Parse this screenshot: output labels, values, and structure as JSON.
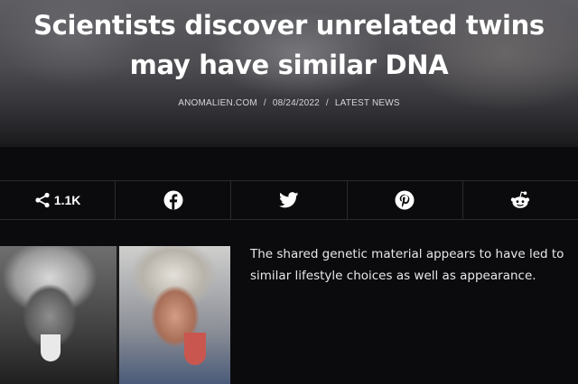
{
  "article": {
    "title": "Scientists discover unrelated twins may have similar DNA",
    "meta": {
      "source": "ANOMALIEN.COM",
      "date": "08/24/2022",
      "category": "LATEST NEWS",
      "separator": "/"
    },
    "body_text": "The shared genetic material appears to have led to similar lifestyle choices as well as appearance."
  },
  "share_bar": {
    "count": "1.1K",
    "buttons": [
      {
        "name": "share",
        "icon": "share-icon"
      },
      {
        "name": "facebook",
        "icon": "facebook-icon"
      },
      {
        "name": "twitter",
        "icon": "twitter-icon"
      },
      {
        "name": "pinterest",
        "icon": "pinterest-icon"
      },
      {
        "name": "reddit",
        "icon": "reddit-icon"
      }
    ]
  },
  "image": {
    "description_icon": "photo-comparison"
  },
  "colors": {
    "background": "#0b0b0e",
    "text": "#ffffff",
    "divider": "#2a2a30"
  }
}
